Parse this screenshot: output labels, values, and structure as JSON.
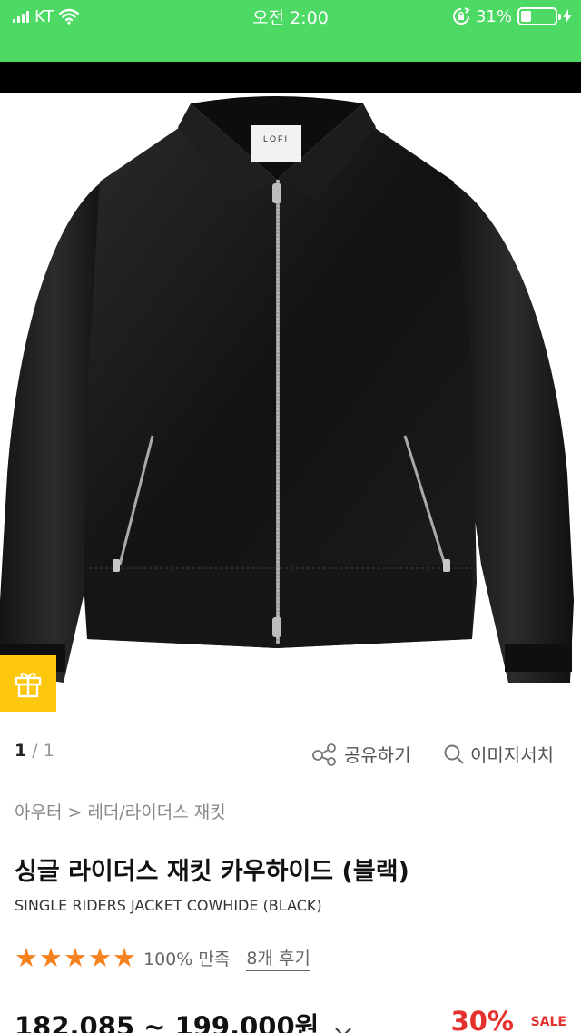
{
  "status_bar": {
    "carrier": "KT",
    "time": "오전 2:00",
    "battery_percent": "31%",
    "battery_level": 0.31
  },
  "gallery": {
    "current": "1",
    "separator": " / ",
    "total": "1",
    "share_label": "공유하기",
    "image_search_label": "이미지서치"
  },
  "product": {
    "breadcrumb": "아우터 > 레더/라이더스 재킷",
    "name_ko": "싱글 라이더스 재킷 카우하이드 (블랙)",
    "name_en": "SINGLE RIDERS JACKET COWHIDE (BLACK)",
    "rating_stars": 5,
    "satisfaction": "100% 만족",
    "reviews": "8개 후기",
    "price": "182,085 ~ 199,000원",
    "discount": "30%",
    "sale_label": "SALE",
    "label_text": "LOFI"
  },
  "colors": {
    "status_bar": "#4cd964",
    "gift": "#fdc70b",
    "star": "#f5821f",
    "discount": "#e4312b"
  },
  "icons": {
    "signal": "signal-icon",
    "wifi": "wifi-icon",
    "rotation_lock": "rotation-lock-icon",
    "battery": "battery-icon",
    "charging": "charging-icon",
    "gift": "gift-icon",
    "share": "share-icon",
    "search": "search-icon",
    "chevron": "chevron-down-icon"
  }
}
